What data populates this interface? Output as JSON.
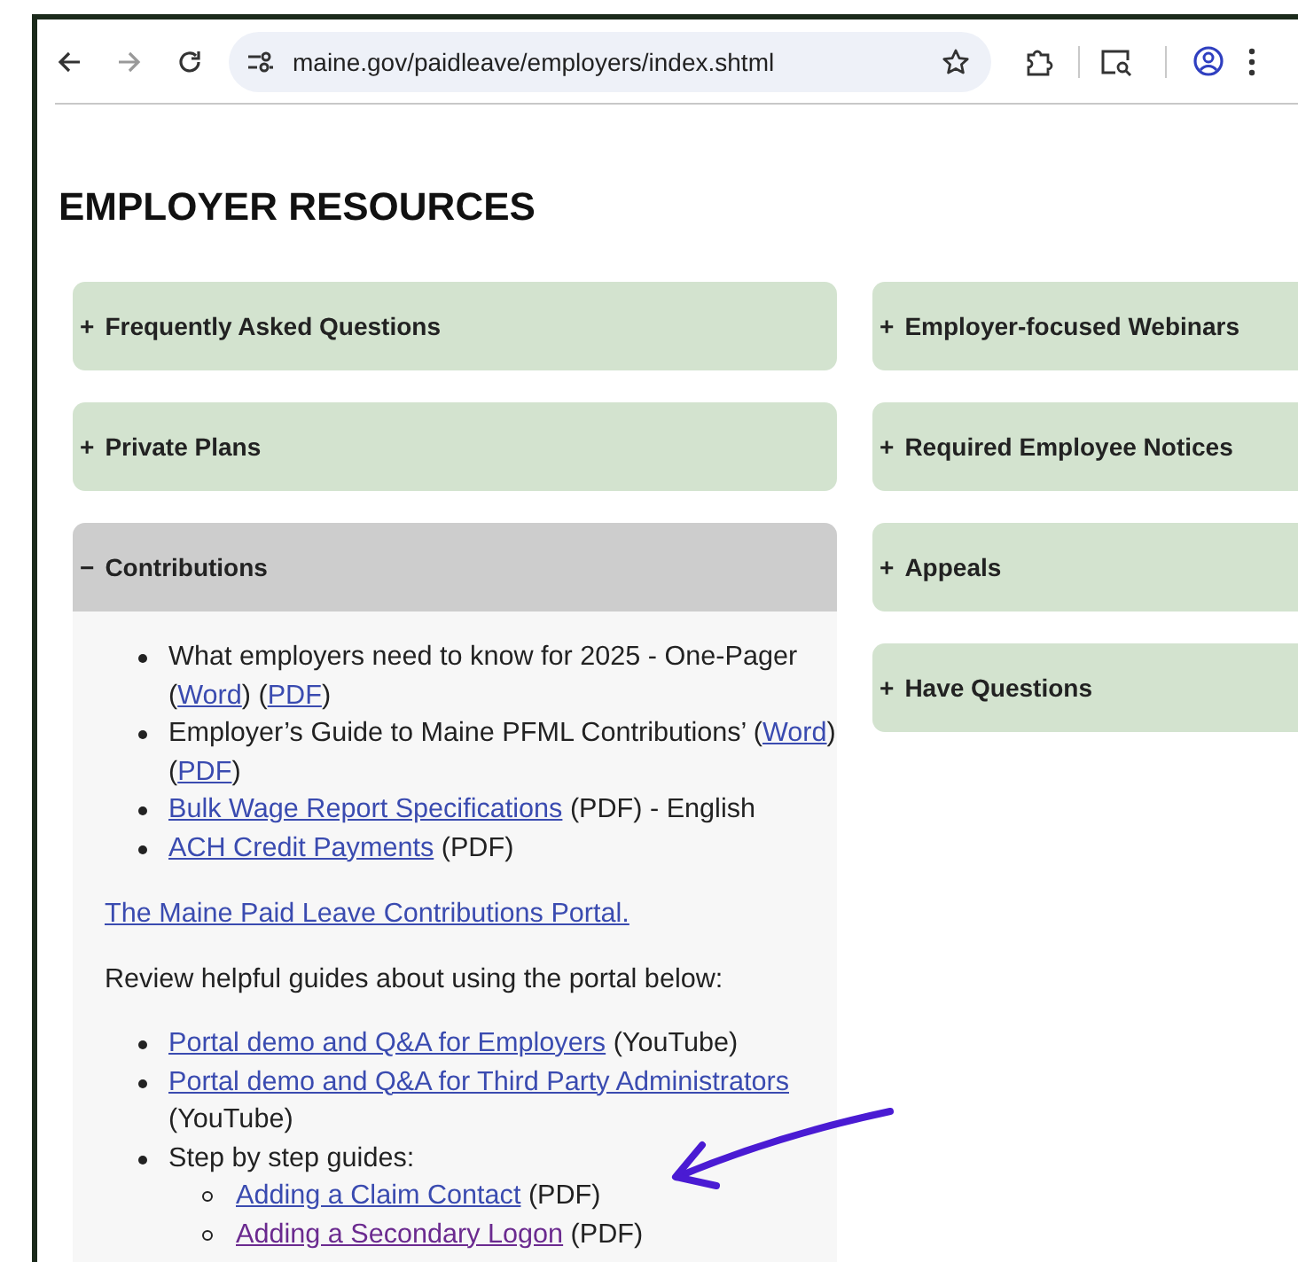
{
  "browser": {
    "url": "maine.gov/paidleave/employers/index.shtml"
  },
  "heading": "EMPLOYER RESOURCES",
  "left_accordions": [
    {
      "symbol": "+",
      "label": "Frequently Asked Questions",
      "expanded": false
    },
    {
      "symbol": "+",
      "label": "Private Plans",
      "expanded": false
    },
    {
      "symbol": "−",
      "label": "Contributions",
      "expanded": true,
      "content": [
        {
          "kind": "list",
          "items": [
            {
              "parts": [
                {
                  "text": "What employers need to know for 2025 - One-Pager ("
                },
                {
                  "text": "Word",
                  "link": true,
                  "visited": false
                },
                {
                  "text": ") ("
                },
                {
                  "text": "PDF",
                  "link": true,
                  "visited": false
                },
                {
                  "text": ")"
                }
              ]
            },
            {
              "parts": [
                {
                  "text": "Employer’s Guide to Maine PFML Contributions’ ("
                },
                {
                  "text": "Word",
                  "link": true,
                  "visited": false
                },
                {
                  "text": ") ("
                },
                {
                  "text": "PDF",
                  "link": true,
                  "visited": false
                },
                {
                  "text": ")"
                }
              ]
            },
            {
              "parts": [
                {
                  "text": "Bulk Wage Report Specifications",
                  "link": true,
                  "visited": false
                },
                {
                  "text": " (PDF) - English"
                }
              ]
            },
            {
              "parts": [
                {
                  "text": "ACH Credit Payments",
                  "link": true,
                  "visited": false
                },
                {
                  "text": " (PDF)"
                }
              ]
            }
          ]
        },
        {
          "kind": "paragraph",
          "parts": [
            {
              "text": "The Maine Paid Leave Contributions Portal.",
              "link": true,
              "visited": false
            }
          ]
        },
        {
          "kind": "paragraph",
          "parts": [
            {
              "text": "Review helpful guides about using the portal below:"
            }
          ]
        },
        {
          "kind": "list",
          "items": [
            {
              "parts": [
                {
                  "text": "Portal demo and Q&A for Employers",
                  "link": true,
                  "visited": false
                },
                {
                  "text": " (YouTube)"
                }
              ]
            },
            {
              "parts": [
                {
                  "text": "Portal demo and Q&A for Third Party Administrators",
                  "link": true,
                  "visited": false
                },
                {
                  "text": " (YouTube)"
                }
              ]
            },
            {
              "parts": [
                {
                  "text": "Step by step guides:"
                }
              ],
              "children": [
                {
                  "parts": [
                    {
                      "text": "Adding a Claim Contact",
                      "link": true,
                      "visited": false
                    },
                    {
                      "text": " (PDF)"
                    }
                  ]
                },
                {
                  "parts": [
                    {
                      "text": "Adding a Secondary Logon",
                      "link": true,
                      "visited": true
                    },
                    {
                      "text": " (PDF)"
                    }
                  ]
                }
              ]
            }
          ]
        }
      ]
    }
  ],
  "right_accordions": [
    {
      "symbol": "+",
      "label": "Employer-focused Webinars",
      "expanded": false
    },
    {
      "symbol": "+",
      "label": "Required Employee Notices",
      "expanded": false
    },
    {
      "symbol": "+",
      "label": "Appeals",
      "expanded": false
    },
    {
      "symbol": "+",
      "label": "Have Questions",
      "expanded": false
    }
  ]
}
